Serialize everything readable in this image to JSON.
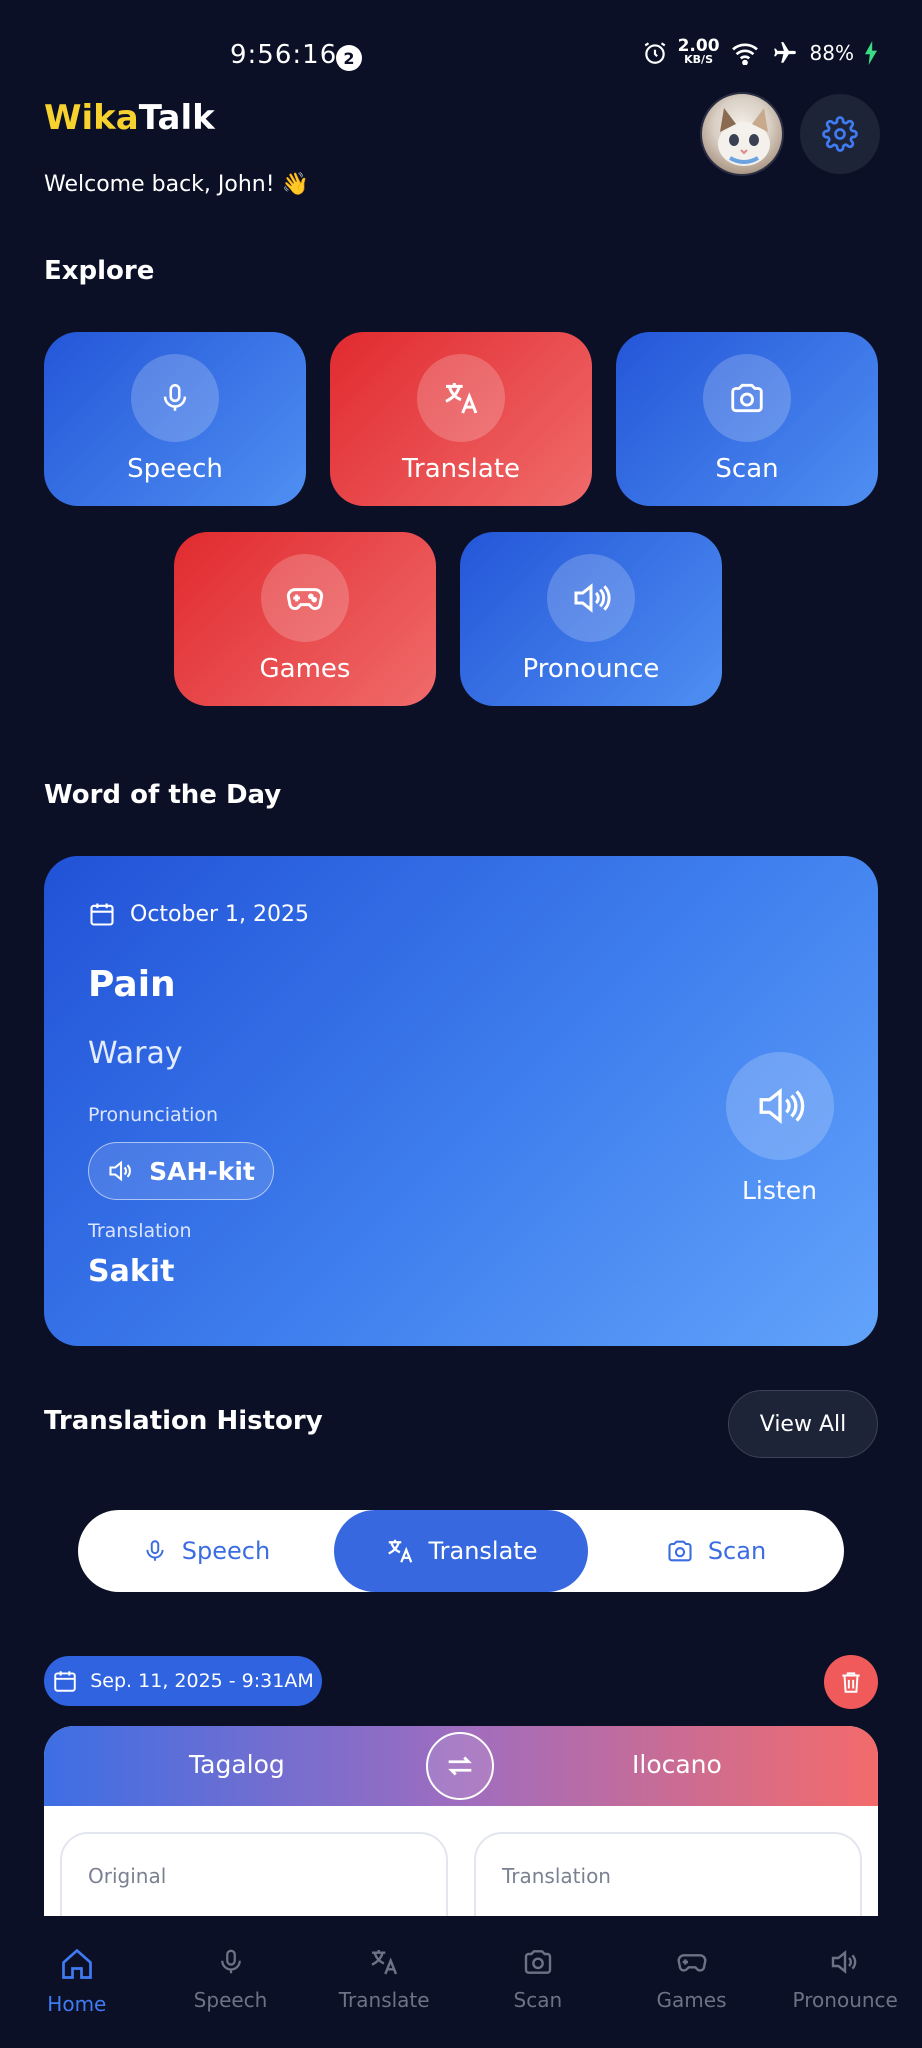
{
  "status_bar": {
    "time": "9:56:16",
    "notification_count": "2",
    "speed_value": "2.00",
    "speed_unit": "KB/S",
    "battery": "88%"
  },
  "header": {
    "brand_part1": "Wika",
    "brand_part2": "Talk",
    "welcome": "Welcome back, John! 👋"
  },
  "explore": {
    "title": "Explore",
    "tiles": [
      {
        "label": "Speech",
        "icon": "mic-icon"
      },
      {
        "label": "Translate",
        "icon": "translate-icon"
      },
      {
        "label": "Scan",
        "icon": "camera-icon"
      },
      {
        "label": "Games",
        "icon": "gamepad-icon"
      },
      {
        "label": "Pronounce",
        "icon": "speaker-icon"
      }
    ]
  },
  "word_of_day": {
    "title": "Word of the Day",
    "date": "October 1, 2025",
    "word": "Pain",
    "language": "Waray",
    "pronunciation_label": "Pronunciation",
    "pronunciation": "SAH-kit",
    "translation_label": "Translation",
    "translation": "Sakit",
    "listen_label": "Listen"
  },
  "history": {
    "title": "Translation History",
    "view_all": "View All",
    "tabs": [
      {
        "label": "Speech",
        "active": false
      },
      {
        "label": "Translate",
        "active": true
      },
      {
        "label": "Scan",
        "active": false
      }
    ],
    "entry": {
      "date": "Sep. 11, 2025 - 9:31AM",
      "source_lang": "Tagalog",
      "target_lang": "Ilocano",
      "original_label": "Original",
      "translation_label": "Translation"
    }
  },
  "bottom_nav": [
    {
      "label": "Home",
      "active": true
    },
    {
      "label": "Speech",
      "active": false
    },
    {
      "label": "Translate",
      "active": false
    },
    {
      "label": "Scan",
      "active": false
    },
    {
      "label": "Games",
      "active": false
    },
    {
      "label": "Pronounce",
      "active": false
    }
  ],
  "colors": {
    "background": "#0b1026",
    "brand_yellow": "#f7d12e",
    "tile_blue": "#2f6ae6",
    "tile_red": "#e83a3c",
    "accent": "#3f7bf2"
  }
}
